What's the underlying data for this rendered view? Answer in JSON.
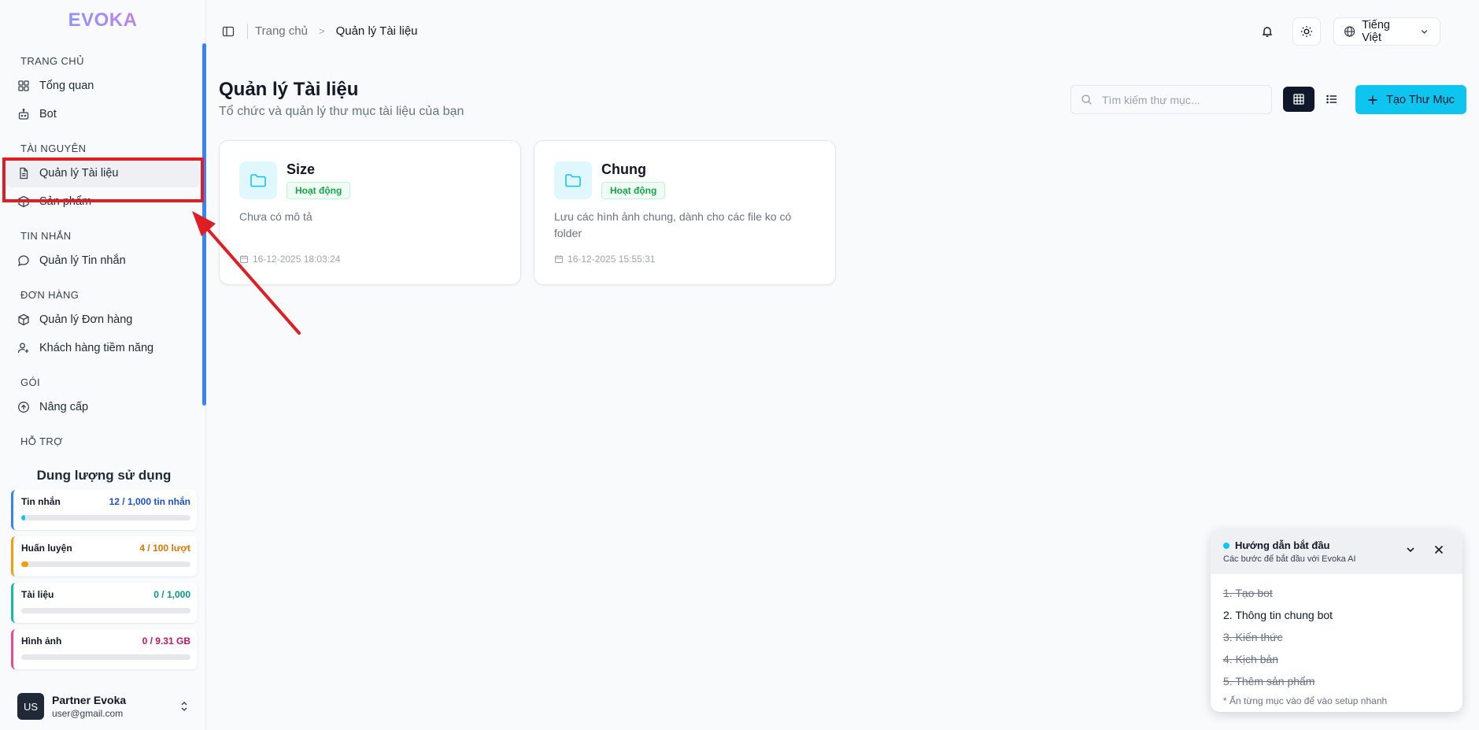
{
  "app": {
    "logo": "EVOKA"
  },
  "sidebar": {
    "sections": [
      {
        "title": "TRANG CHỦ",
        "items": [
          {
            "label": "Tổng quan",
            "icon": "dashboard-icon"
          },
          {
            "label": "Bot",
            "icon": "bot-icon"
          }
        ]
      },
      {
        "title": "TÀI NGUYÊN",
        "items": [
          {
            "label": "Quản lý Tài liệu",
            "icon": "document-icon"
          },
          {
            "label": "Sản phẩm",
            "icon": "package-icon"
          }
        ]
      },
      {
        "title": "TIN NHẮN",
        "items": [
          {
            "label": "Quản lý Tin nhắn",
            "icon": "message-icon"
          }
        ]
      },
      {
        "title": "ĐƠN HÀNG",
        "items": [
          {
            "label": "Quản lý Đơn hàng",
            "icon": "package-icon"
          },
          {
            "label": "Khách hàng tiềm năng",
            "icon": "user-plus-icon"
          }
        ]
      },
      {
        "title": "GÓI",
        "items": [
          {
            "label": "Nâng cấp",
            "icon": "upgrade-icon"
          }
        ]
      },
      {
        "title": "HỖ TRỢ",
        "items": []
      }
    ],
    "active": "Quản lý Tài liệu"
  },
  "usage": {
    "title": "Dung lượng sử dụng",
    "items": [
      {
        "label": "Tin nhắn",
        "value": "12 / 1,000 tin nhắn",
        "fraction": 0.012,
        "color": "#3b82f6",
        "value_color": "#1d4ed8",
        "fill_color": "#0ec5f0"
      },
      {
        "label": "Huấn luyện",
        "value": "4 / 100 lượt",
        "fraction": 0.04,
        "color": "#f59e0b",
        "value_color": "#d97706",
        "fill_color": "#f59e0b"
      },
      {
        "label": "Tài liệu",
        "value": "0 / 1,000",
        "fraction": 0,
        "color": "#14b8a6",
        "value_color": "#0d9488",
        "fill_color": "#14b8a6"
      },
      {
        "label": "Hình ảnh",
        "value": "0 / 9.31 GB",
        "fraction": 0,
        "color": "#ec4899",
        "value_color": "#be185d",
        "fill_color": "#ec4899"
      }
    ]
  },
  "user": {
    "initials": "US",
    "name": "Partner Evoka",
    "email": "user@gmail.com"
  },
  "header": {
    "breadcrumb": {
      "home": "Trang chủ",
      "separator": ">",
      "current": "Quản lý Tài liệu"
    },
    "language": "Tiếng Việt"
  },
  "page": {
    "title": "Quản lý Tài liệu",
    "subtitle": "Tổ chức và quản lý thư mục tài liệu của bạn",
    "search_placeholder": "Tìm kiếm thư mục...",
    "create_label": "Tạo Thư Mục"
  },
  "folders": [
    {
      "name": "Size",
      "status": "Hoạt động",
      "description": "Chưa có mô tả",
      "date": "16-12-2025 18:03:24"
    },
    {
      "name": "Chung",
      "status": "Hoạt động",
      "description": "Lưu các hình ảnh chung, dành cho các file ko có folder",
      "date": "16-12-2025 15:55:31"
    }
  ],
  "guide": {
    "title": "Hướng dẫn bắt đầu",
    "subtitle": "Các bước để bắt đầu với Evoka AI",
    "steps": [
      {
        "label": "1. Tạo bot",
        "done": true
      },
      {
        "label": "2. Thông tin chung bot",
        "done": false
      },
      {
        "label": "3. Kiến thức",
        "done": true
      },
      {
        "label": "4. Kịch bản",
        "done": true
      },
      {
        "label": "5. Thêm sản phẩm",
        "done": true
      }
    ],
    "hint": "* Ấn từng mục vào để vào setup nhanh"
  },
  "colors": {
    "accent": "#0ec5f0",
    "annotation": "#e11d24",
    "active_status": "#16a34a"
  }
}
